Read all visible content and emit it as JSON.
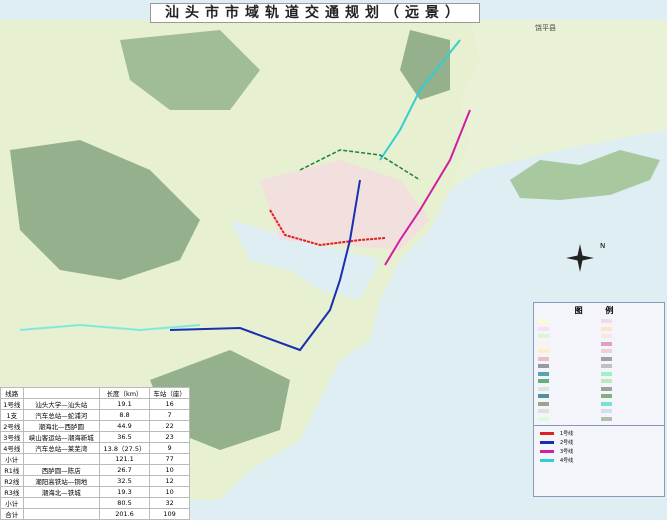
{
  "title": "汕头市市域轨道交通规划（远景）",
  "table": {
    "headers": [
      "线路",
      "",
      "长度（km）",
      "车站（座）"
    ],
    "rows": [
      [
        "1号线",
        "汕头大学—汕头站",
        "19.1",
        "16"
      ],
      [
        "1支",
        "汽车总站—蛇浦河",
        "8.8",
        "7"
      ],
      [
        "2号线",
        "潮海北—西胪圆",
        "44.9",
        "22"
      ],
      [
        "3号线",
        "峡山客运站—潮海新城",
        "36.5",
        "23"
      ],
      [
        "4号线",
        "汽车总站—莱芜湾",
        "13.8（27.5）",
        "9"
      ],
      [
        "小计",
        "",
        "121.1",
        "77"
      ],
      [
        "R1线",
        "西胪圆—陈店",
        "26.7",
        "10"
      ],
      [
        "R2线",
        "潮阳高铁站—铜地",
        "32.5",
        "12"
      ],
      [
        "R3线",
        "潮海北—铁城",
        "19.3",
        "10"
      ],
      [
        "小计",
        "",
        "80.5",
        "32"
      ],
      [
        "合计",
        "",
        "201.6",
        "109"
      ]
    ]
  },
  "legend": {
    "title": "图 例",
    "lines": [
      {
        "label": "1号线",
        "color": "#e02020"
      },
      {
        "label": "2号线",
        "color": "#1a2fb0"
      },
      {
        "label": "3号线",
        "color": "#d020a0"
      },
      {
        "label": "4号线",
        "color": "#30d0d0"
      }
    ],
    "colors": [
      "#fbfbd0",
      "#f7d9e6",
      "#f5e1ef",
      "#fde5c9",
      "#d9f7d0",
      "#f7e6e6",
      "#fff0f0",
      "#e0a0c0",
      "#fdf0c0",
      "#f0d0d0",
      "#e8c0c0",
      "#a0a0a8",
      "#9898a8",
      "#c0c0c8",
      "#60a0b0",
      "#a0f0c0",
      "#60b080",
      "#c0e8c0",
      "#d8e8d8",
      "#a0a0a0",
      "#5090a0",
      "#80b080",
      "#a0a090",
      "#80e0d0",
      "#e0e0e0",
      "#d0e0f0",
      "#e0f8e0",
      "#b0c0b0"
    ]
  },
  "places": {
    "north_county": "饶平县",
    "compass": "N"
  },
  "colors": {
    "sea": "#dfeef3",
    "land": "#e7f0d0",
    "mountain": "#7fa07a"
  }
}
